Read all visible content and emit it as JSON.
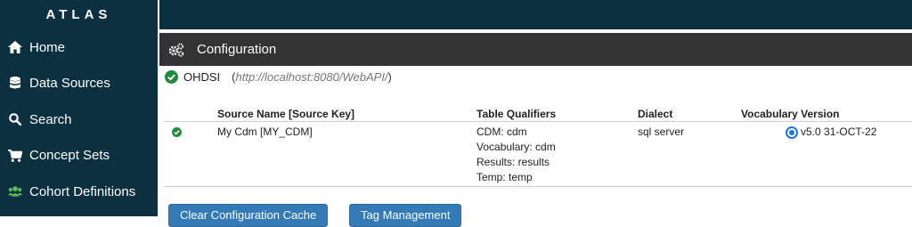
{
  "app": {
    "brand": "ATLAS"
  },
  "sidebar": {
    "items": [
      {
        "label": "Home",
        "icon": "home-icon"
      },
      {
        "label": "Data Sources",
        "icon": "database-icon"
      },
      {
        "label": "Search",
        "icon": "search-icon"
      },
      {
        "label": "Concept Sets",
        "icon": "shopping-cart-icon"
      },
      {
        "label": "Cohort Definitions",
        "icon": "users-icon"
      }
    ]
  },
  "panel": {
    "title": "Configuration",
    "icon": "cogs-icon"
  },
  "source": {
    "name": "OHDSI",
    "url_open": "(",
    "url": "http://localhost:8080/WebAPI/",
    "url_close": ")",
    "status_icon": "check-circle-icon"
  },
  "table": {
    "headers": [
      "Source Name [Source Key]",
      "Table Qualifiers",
      "Dialect",
      "Vocabulary Version"
    ],
    "rows": [
      {
        "source": "My Cdm [MY_CDM]",
        "qualifiers": [
          "CDM: cdm",
          "Vocabulary: cdm",
          "Results: results",
          "Temp: temp"
        ],
        "dialect": "sql server",
        "vocabulary": "v5.0 31-OCT-22"
      }
    ]
  },
  "buttons": {
    "clear_cache": "Clear Configuration Cache",
    "tag_management": "Tag Management"
  },
  "colors": {
    "sidebar_bg": "#0b3040",
    "panel_header_bg": "#333333",
    "success_green": "#1e8a3c",
    "accent_blue": "#1a73e8",
    "button_blue": "#337ab7"
  }
}
